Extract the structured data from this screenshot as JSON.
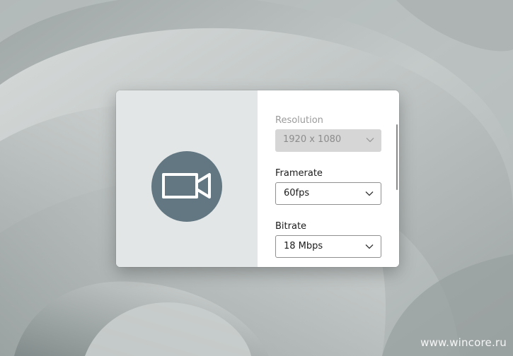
{
  "settings": {
    "resolution": {
      "label": "Resolution",
      "value": "1920 x 1080",
      "enabled": false
    },
    "framerate": {
      "label": "Framerate",
      "value": "60fps",
      "enabled": true
    },
    "bitrate": {
      "label": "Bitrate",
      "value": "18 Mbps",
      "enabled": true
    }
  },
  "preview": {
    "icon": "video-camera-icon"
  },
  "watermark": "www.wincore.ru",
  "colors": {
    "camera_circle": "#627782",
    "preview_bg": "#e2e6e7",
    "disabled_select_bg": "#d6d6d6"
  }
}
